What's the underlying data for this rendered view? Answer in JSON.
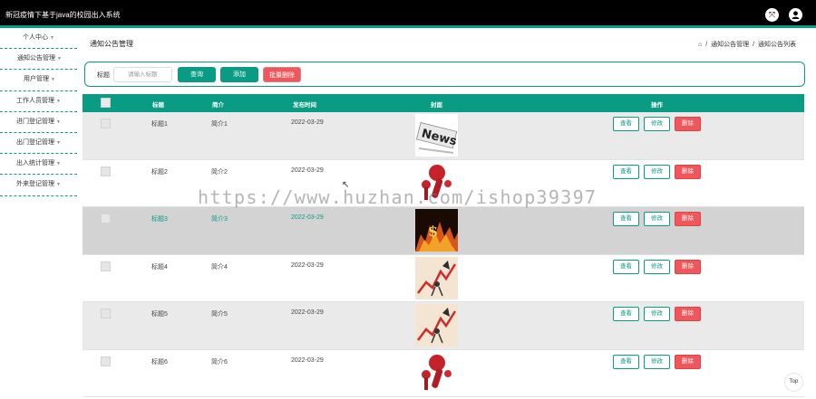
{
  "header": {
    "title": "新冠疫情下基于java的校园出入系统",
    "icons": [
      "fullscreen-icon",
      "user-avatar-icon"
    ]
  },
  "sidebar": {
    "items": [
      {
        "label": "个人中心"
      },
      {
        "label": "通知公告管理"
      },
      {
        "label": "用户管理"
      },
      {
        "label": "工作人员管理"
      },
      {
        "label": "进门登记管理"
      },
      {
        "label": "出门登记管理"
      },
      {
        "label": "出入统计管理"
      },
      {
        "label": "外来登记管理"
      }
    ]
  },
  "page": {
    "title": "通知公告管理",
    "breadcrumb": {
      "home_icon": "home-icon",
      "sep1": "/",
      "level1": "通知公告管理",
      "sep2": "/",
      "level2": "通知公告列表"
    }
  },
  "search": {
    "label": "标题",
    "placeholder": "请输入标题",
    "query_button": "查询",
    "add_button": "添加",
    "batch_delete_button": "批量删除"
  },
  "table": {
    "headers": {
      "title": "标题",
      "intro": "简介",
      "time": "发布时间",
      "cover": "封面",
      "ops": "操作"
    },
    "actions": {
      "view": "查看",
      "edit": "修改",
      "delete": "删除"
    },
    "rows": [
      {
        "title": "标题1",
        "intro": "简介1",
        "time": "2022-03-29",
        "cover": "news-image"
      },
      {
        "title": "标题2",
        "intro": "简介2",
        "time": "2022-03-29",
        "cover": "microphone-image"
      },
      {
        "title": "标题3",
        "intro": "简介3",
        "time": "2022-03-29",
        "cover": "fire-dollar-image"
      },
      {
        "title": "标题4",
        "intro": "简介4",
        "time": "2022-03-29",
        "cover": "stock-chart-image"
      },
      {
        "title": "标题5",
        "intro": "简介5",
        "time": "2022-03-29",
        "cover": "stock-chart-image"
      },
      {
        "title": "标题6",
        "intro": "简介6",
        "time": "2022-03-29",
        "cover": "microphone-image"
      }
    ]
  },
  "watermark": "https://www.huzhan.com/ishop39397",
  "back_to_top": "Top",
  "colors": {
    "accent": "#0a9b84",
    "danger": "#f0575c",
    "topbar": "#000000"
  }
}
